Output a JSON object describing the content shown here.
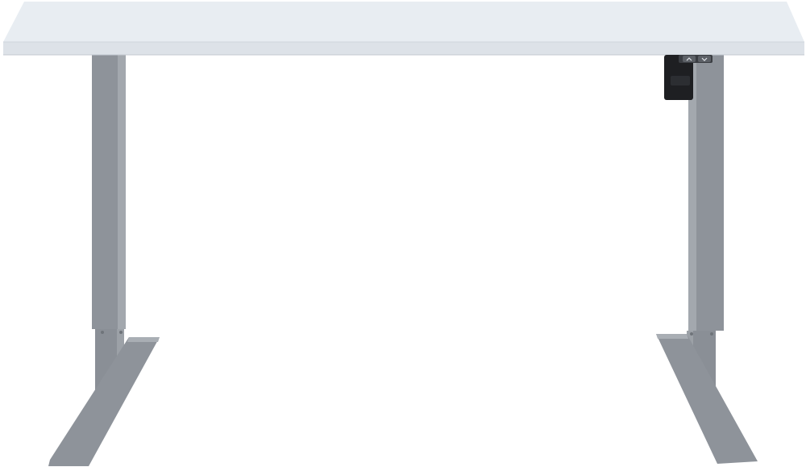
{
  "image": {
    "subject": "height-adjustable-desk",
    "background_color": "#ffffff"
  },
  "colors": {
    "desktop_top": "#e8edf2",
    "desktop_edge": "#d9dee4",
    "frame_gray": "#8e939a",
    "frame_dark": "#7d8289",
    "frame_light": "#a3a8ae",
    "control_box": "#1e1f22",
    "control_buttons": "#5c6066"
  },
  "icons": {
    "up_button": "chevron-up-icon",
    "down_button": "chevron-down-icon"
  }
}
